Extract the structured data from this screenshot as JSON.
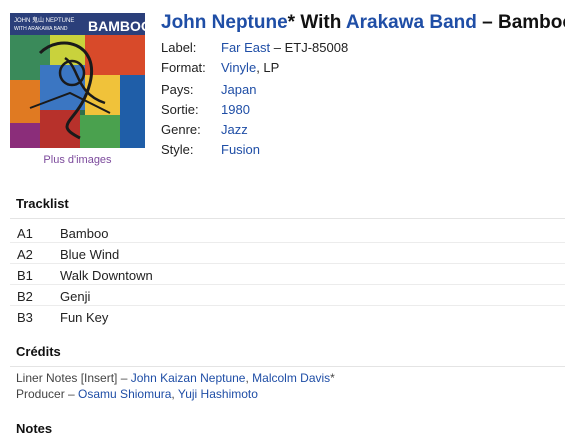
{
  "release": {
    "artist_1": "John Neptune",
    "artist_1_suffix": "* With ",
    "artist_2": "Arakawa Band",
    "title_sep": " – ",
    "album": "Bamboo",
    "cover_text_top": "JOHN 鬼山 NEPTUNE",
    "cover_text_sub": "WITH ARAKAWA BAND",
    "cover_text_big": "BAMBOO",
    "more_images": "Plus d'images"
  },
  "meta": {
    "label_key": "Label:",
    "label_link": "Far East",
    "label_rest": " – ETJ-85008",
    "format_key": "Format:",
    "format_link": "Vinyle",
    "format_rest": ", LP",
    "country_key": "Pays:",
    "country_val": "Japan",
    "released_key": "Sortie:",
    "released_val": "1980",
    "genre_key": "Genre:",
    "genre_val": "Jazz",
    "style_key": "Style:",
    "style_val": "Fusion"
  },
  "tracklist": {
    "heading": "Tracklist",
    "tracks": [
      {
        "pos": "A1",
        "title": "Bamboo"
      },
      {
        "pos": "A2",
        "title": "Blue Wind"
      },
      {
        "pos": "B1",
        "title": "Walk Downtown"
      },
      {
        "pos": "B2",
        "title": "Genji"
      },
      {
        "pos": "B3",
        "title": "Fun Key"
      }
    ]
  },
  "credits": {
    "heading": "Crédits",
    "line1_role": "Liner Notes [Insert] – ",
    "line1_link1": "John Kaizan Neptune",
    "line1_sep": ", ",
    "line1_link2": "Malcolm Davis",
    "line1_suffix": "*",
    "line2_role": "Producer – ",
    "line2_link1": "Osamu Shiomura",
    "line2_sep": ", ",
    "line2_link2": "Yuji Hashimoto"
  },
  "notes": {
    "heading": "Notes"
  }
}
